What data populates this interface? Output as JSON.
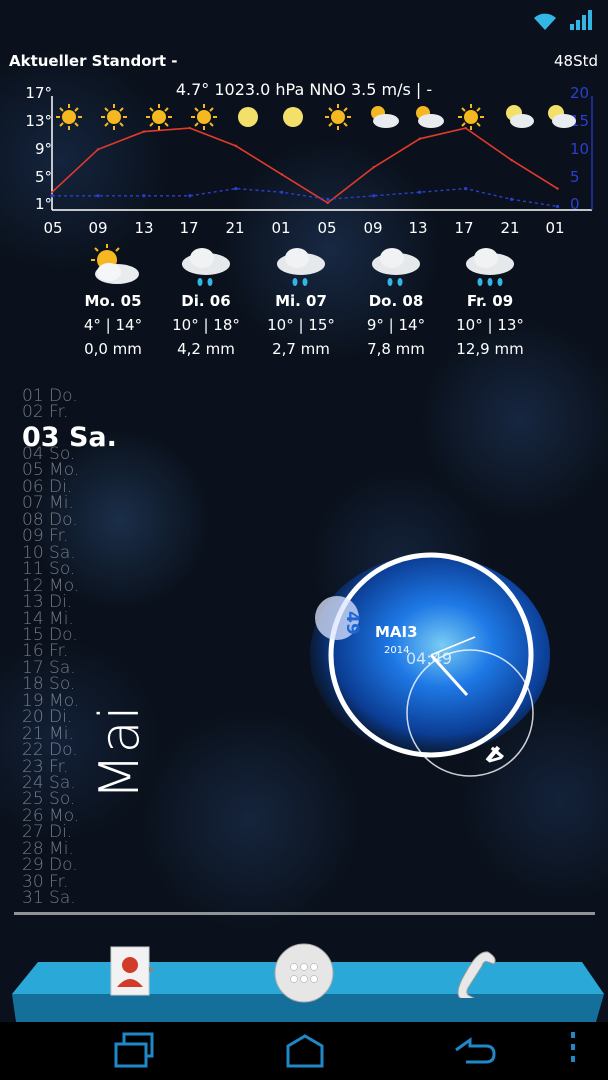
{
  "weather": {
    "location": "Aktueller Standort -",
    "range": "48Std",
    "current": "4.7° 1023.0 hPa NNO 3.5 m/s | -",
    "y_left_ticks": [
      "17°",
      "13°",
      "9°",
      "5°",
      "1°"
    ],
    "y_right_ticks": [
      "20",
      "15",
      "10",
      "5",
      "0"
    ],
    "x_ticks": [
      "05",
      "09",
      "13",
      "17",
      "21",
      "01",
      "05",
      "09",
      "13",
      "17",
      "21",
      "01"
    ],
    "days": [
      {
        "name": "Mo. 05",
        "temps": "4° | 14°",
        "rain": "0,0 mm",
        "icon": "sun-cloud-icon"
      },
      {
        "name": "Di. 06",
        "temps": "10° | 18°",
        "rain": "4,2 mm",
        "icon": "rain-cloud-icon"
      },
      {
        "name": "Mi. 07",
        "temps": "10° | 15°",
        "rain": "2,7 mm",
        "icon": "rain-cloud-icon"
      },
      {
        "name": "Do. 08",
        "temps": "9° | 14°",
        "rain": "7,8 mm",
        "icon": "rain-cloud-icon"
      },
      {
        "name": "Fr. 09",
        "temps": "10° | 13°",
        "rain": "12,9 mm",
        "icon": "rain-cloud-icon"
      }
    ]
  },
  "chart_data": {
    "type": "line",
    "x": [
      "05",
      "09",
      "13",
      "17",
      "21",
      "01",
      "05",
      "09",
      "13",
      "17",
      "21",
      "01"
    ],
    "series": [
      {
        "values": [
          3.5,
          9.5,
          12,
          12.5,
          10,
          6,
          2,
          7,
          11,
          12.5,
          8,
          4
        ]
      },
      {
        "values": [
          3,
          3,
          3,
          3,
          4,
          3.5,
          2.5,
          3,
          3.5,
          4,
          2.5,
          1.5
        ]
      }
    ],
    "ylim": [
      1,
      17
    ],
    "y2lim": [
      0,
      20
    ],
    "colors": {
      "temperature": "#e23a2a",
      "secondary": "#2a3fd0"
    }
  },
  "clock": {
    "month_label": "MAI3",
    "year": "2014",
    "time": "04:49",
    "minute_badge": "49",
    "hour_label": "4"
  },
  "calendar": {
    "days_before": [
      "01 Do.",
      "02 Fr."
    ],
    "today": "03 Sa.",
    "days_after": [
      "04 So.",
      "05 Mo.",
      "06 Di.",
      "07 Mi.",
      "08 Do.",
      "09 Fr.",
      "10 Sa.",
      "11 So.",
      "12 Mo.",
      "13 Di.",
      "14 Mi.",
      "15 Do.",
      "16 Fr.",
      "17 Sa.",
      "18 So.",
      "19 Mo.",
      "20 Di.",
      "21 Mi.",
      "22 Do.",
      "23 Fr.",
      "24 Sa.",
      "25 So.",
      "26 Mo.",
      "27 Di.",
      "28 Mi.",
      "29 Do.",
      "30 Fr.",
      "31 Sa."
    ],
    "month": "Mai"
  },
  "colors": {
    "accent": "#33b5e5",
    "dock": "#2aa8d8",
    "clock_glow": "#1f7ef0"
  }
}
